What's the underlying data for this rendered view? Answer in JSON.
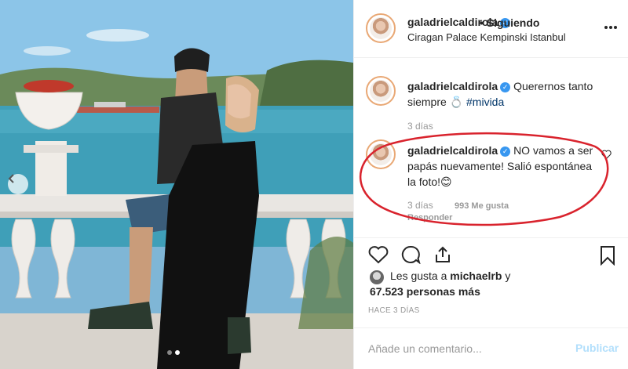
{
  "header": {
    "username": "galadrielcaldirola",
    "follow_status": "• Siguiendo",
    "location": "Ciragan Palace Kempinski Istanbul",
    "more_icon": "more-horizontal-icon",
    "verified_mark": "✓"
  },
  "caption": {
    "username": "galadrielcaldirola",
    "text": "Querernos tanto siempre 💍",
    "hashtag": "#mivida",
    "time": "3 días"
  },
  "comment": {
    "username": "galadrielcaldirola",
    "text": "NO vamos a ser papás nuevamente! Salió espontánea la foto!😊",
    "time": "3 días",
    "likes": "993 Me gusta",
    "reply": "Responder"
  },
  "actions": {
    "like_icon": "heart-icon",
    "comment_icon": "comment-icon",
    "share_icon": "share-icon",
    "save_icon": "bookmark-icon"
  },
  "likes": {
    "prefix": "Les gusta a",
    "user": "michaelrb",
    "connector": "y",
    "count_text": "67.523 personas más"
  },
  "post_date": "HACE 3 DÍAS",
  "add_comment": {
    "placeholder": "Añade un comentario...",
    "publish_label": "Publicar"
  },
  "colors": {
    "accent_blue": "#3897f0",
    "highlight_red": "#d9232d",
    "publish_disabled": "#b2dffc"
  }
}
